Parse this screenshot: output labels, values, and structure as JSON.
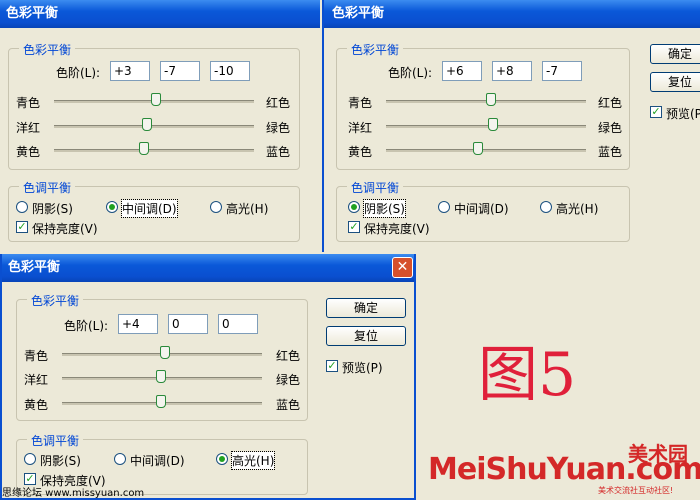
{
  "dialog_title": "色彩平衡",
  "group_color_balance": "色彩平衡",
  "group_tone_balance": "色调平衡",
  "levels_label": "色阶(L):",
  "slider_labels": {
    "cyan": "青色",
    "red": "红色",
    "magenta": "洋红",
    "green": "绿色",
    "yellow": "黄色",
    "blue": "蓝色"
  },
  "tone_options": {
    "shadows": "阴影(S)",
    "midtones": "中间调(D)",
    "highlights": "高光(H)"
  },
  "preserve_luminosity": "保持亮度(V)",
  "buttons": {
    "ok": "确定",
    "reset": "复位",
    "preview": "预览(P)"
  },
  "dialogs": [
    {
      "levels": [
        "+3",
        "-7",
        "-10"
      ],
      "tone": "midtones",
      "preserve": true
    },
    {
      "levels": [
        "+6",
        "+8",
        "-7"
      ],
      "tone": "shadows",
      "preserve": true,
      "preview": true
    },
    {
      "levels": [
        "+4",
        "0",
        "0"
      ],
      "tone": "highlights",
      "preserve": true,
      "preview": true
    }
  ],
  "figure_label": "图5",
  "brand": {
    "name": "MeiShuYuan.com",
    "cn": "美术园",
    "tagline": "美术交流社互动社区!"
  },
  "watermark": "思缘论坛 www.missyuan.com"
}
